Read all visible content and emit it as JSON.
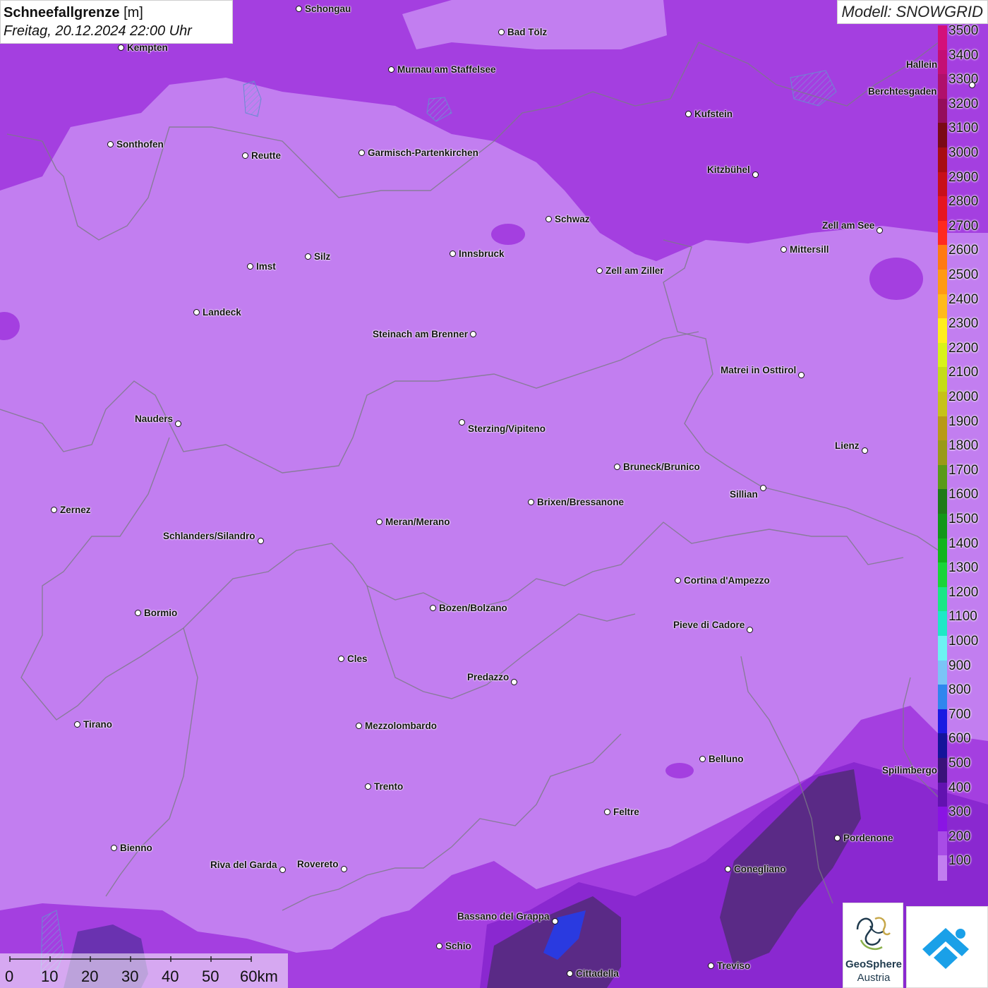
{
  "header": {
    "title_bold": "Schneefallgrenze",
    "title_unit": "[m]",
    "datetime": "Freitag, 20.12.2024 22:00 Uhr",
    "model": "Modell: SNOWGRID"
  },
  "legend": {
    "levels": [
      {
        "label": "3500",
        "color": "#d4107a"
      },
      {
        "label": "3400",
        "color": "#c40f74"
      },
      {
        "label": "3300",
        "color": "#b0106b"
      },
      {
        "label": "3200",
        "color": "#950d5c"
      },
      {
        "label": "3100",
        "color": "#7a0a16"
      },
      {
        "label": "3000",
        "color": "#a80d12"
      },
      {
        "label": "2900",
        "color": "#c8101a"
      },
      {
        "label": "2800",
        "color": "#e61620"
      },
      {
        "label": "2700",
        "color": "#ff2a1f"
      },
      {
        "label": "2600",
        "color": "#ff7a12"
      },
      {
        "label": "2500",
        "color": "#ff9a14"
      },
      {
        "label": "2400",
        "color": "#ffba1a"
      },
      {
        "label": "2300",
        "color": "#ffee1c"
      },
      {
        "label": "2200",
        "color": "#d8f21a"
      },
      {
        "label": "2100",
        "color": "#c4dc17"
      },
      {
        "label": "2000",
        "color": "#c6c218"
      },
      {
        "label": "1900",
        "color": "#b89a18"
      },
      {
        "label": "1800",
        "color": "#9a9a1a"
      },
      {
        "label": "1700",
        "color": "#5a9a1a"
      },
      {
        "label": "1600",
        "color": "#1f7a1a"
      },
      {
        "label": "1500",
        "color": "#12961a"
      },
      {
        "label": "1400",
        "color": "#12b41c"
      },
      {
        "label": "1300",
        "color": "#1ad43a"
      },
      {
        "label": "1200",
        "color": "#1ae686"
      },
      {
        "label": "1100",
        "color": "#1ee8c6"
      },
      {
        "label": "1000",
        "color": "#6cf2f2"
      },
      {
        "label": "900",
        "color": "#7ac4f6"
      },
      {
        "label": "800",
        "color": "#2f86ee"
      },
      {
        "label": "700",
        "color": "#1a1ae2"
      },
      {
        "label": "600",
        "color": "#14149a"
      },
      {
        "label": "500",
        "color": "#3a127a"
      },
      {
        "label": "400",
        "color": "#6212b0"
      },
      {
        "label": "300",
        "color": "#8a14e4"
      },
      {
        "label": "200",
        "color": "#a84ce6"
      },
      {
        "label": "100",
        "color": "#c27ef0"
      }
    ]
  },
  "cities": [
    {
      "name": "Schongau"
    },
    {
      "name": "Bad Tölz"
    },
    {
      "name": "Kempten"
    },
    {
      "name": "Murnau am Staffelsee"
    },
    {
      "name": "Berchtesgaden"
    },
    {
      "name": "Kufstein"
    },
    {
      "name": "Sonthofen"
    },
    {
      "name": "Reutte"
    },
    {
      "name": "Garmisch-Partenkirchen"
    },
    {
      "name": "Kitzbühel"
    },
    {
      "name": "Schwaz"
    },
    {
      "name": "Zell am See"
    },
    {
      "name": "Innsbruck"
    },
    {
      "name": "Mittersill"
    },
    {
      "name": "Imst"
    },
    {
      "name": "Silz"
    },
    {
      "name": "Zell am Ziller"
    },
    {
      "name": "Landeck"
    },
    {
      "name": "Steinach am Brenner"
    },
    {
      "name": "Matrei in Osttirol"
    },
    {
      "name": "Nauders"
    },
    {
      "name": "Sterzing/Vipiteno"
    },
    {
      "name": "Lienz"
    },
    {
      "name": "Bruneck/Brunico"
    },
    {
      "name": "Sillian"
    },
    {
      "name": "Zernez"
    },
    {
      "name": "Brixen/Bressanone"
    },
    {
      "name": "Meran/Merano"
    },
    {
      "name": "Schlanders/Silandro"
    },
    {
      "name": "Cortina d'Ampezzo"
    },
    {
      "name": "Bozen/Bolzano"
    },
    {
      "name": "Bormio"
    },
    {
      "name": "Pieve di Cadore"
    },
    {
      "name": "Cles"
    },
    {
      "name": "Predazzo"
    },
    {
      "name": "Tirano"
    },
    {
      "name": "Mezzolombardo"
    },
    {
      "name": "Belluno"
    },
    {
      "name": "Spilimbergo"
    },
    {
      "name": "Trento"
    },
    {
      "name": "Feltre"
    },
    {
      "name": "Pordenone"
    },
    {
      "name": "Bienno"
    },
    {
      "name": "Riva del Garda"
    },
    {
      "name": "Rovereto"
    },
    {
      "name": "Conegliano"
    },
    {
      "name": "Bassano del Grappa"
    },
    {
      "name": "Schio"
    },
    {
      "name": "Treviso"
    },
    {
      "name": "Cittadella"
    },
    {
      "name": "Hallein"
    }
  ],
  "scalebar": {
    "ticks": [
      "0",
      "10",
      "20",
      "30",
      "40",
      "50",
      "60km"
    ]
  },
  "logos": {
    "geosphere_line1": "GeoSphere",
    "geosphere_line2": "Austria"
  }
}
